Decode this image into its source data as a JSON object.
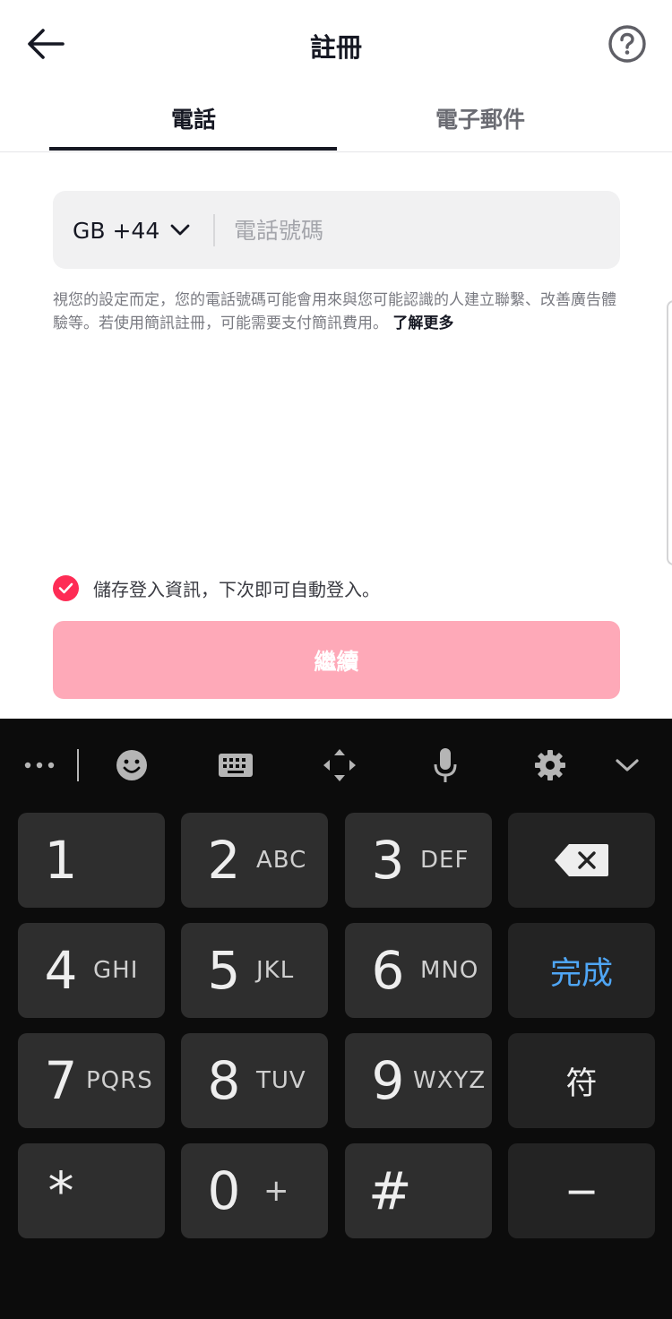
{
  "header": {
    "title": "註冊",
    "back_icon": "arrow-left-icon",
    "help_icon": "question-circle-icon"
  },
  "tabs": [
    {
      "label": "電話",
      "active": true
    },
    {
      "label": "電子郵件",
      "active": false
    }
  ],
  "phone": {
    "country_code": "GB +44",
    "placeholder": "電話號碼",
    "value": ""
  },
  "disclaimer": {
    "text": "視您的設定而定，您的電話號碼可能會用來與您可能認識的人建立聯繫、改善廣告體驗等。若使用簡訊註冊，可能需要支付簡訊費用。",
    "learn_more": "了解更多"
  },
  "save_login": {
    "checked": true,
    "label": "儲存登入資訊，下次即可自動登入。"
  },
  "continue_button": {
    "label": "繼續",
    "enabled": false
  },
  "colors": {
    "brand": "#fe2c55",
    "button_disabled": "#fea9b8",
    "keyboard_bg": "#0c0c0c",
    "done_blue": "#4fa6f5"
  },
  "keyboard": {
    "toolbar": [
      "more-icon",
      "emoji-icon",
      "keyboard-icon",
      "cursor-move-icon",
      "microphone-icon",
      "settings-icon",
      "collapse-icon"
    ],
    "keys": [
      {
        "num": "1",
        "letters": ""
      },
      {
        "num": "2",
        "letters": "ABC"
      },
      {
        "num": "3",
        "letters": "DEF"
      },
      {
        "num": "4",
        "letters": "GHI"
      },
      {
        "num": "5",
        "letters": "JKL"
      },
      {
        "num": "6",
        "letters": "MNO"
      },
      {
        "num": "7",
        "letters": "PQRS"
      },
      {
        "num": "8",
        "letters": "TUV"
      },
      {
        "num": "9",
        "letters": "WXYZ"
      },
      {
        "num": "*",
        "letters": ""
      },
      {
        "num": "0",
        "letters": "+"
      },
      {
        "num": "#",
        "letters": ""
      }
    ],
    "done_label": "完成",
    "symbols_label": "符",
    "minus_label": "−",
    "backspace_icon": "backspace-icon"
  }
}
